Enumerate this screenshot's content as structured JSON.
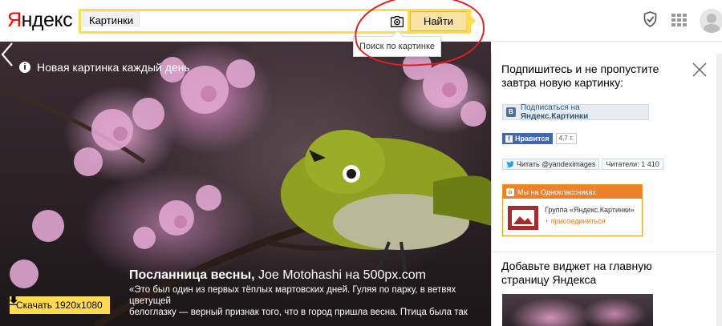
{
  "header": {
    "logo_first": "Я",
    "logo_rest": "ндекс",
    "search_tag": "Картинки",
    "search_value": "",
    "search_button": "Найти",
    "camera_tooltip": "Поиск по картинке",
    "icons": [
      "camera-icon",
      "shield-icon",
      "apps-grid-icon",
      "avatar-icon"
    ]
  },
  "hero": {
    "title": "Новая картинка каждый день",
    "caption_title": "Посланница весны,",
    "caption_author": " Joe Motohashi на 500px.com",
    "caption_text": "«Это был один из первых тёплых мартовских дней. Гуляя по парку, в ветвях цветущей\nбелоглазку — верный признак того, что в город пришла весна. Птица была так увлечен\nмне удалось подойти поближе и сфотографировать её».",
    "download_label": "Скачать 1920x1080"
  },
  "sidebar": {
    "heading": "Подпишитесь и не пропустите завтра новую картинку:",
    "vk": {
      "prefix": "Подписаться на ",
      "name": "Яндекс.Картинки"
    },
    "facebook": {
      "like_label": "Нравится",
      "count": "4,7 т."
    },
    "twitter": {
      "follow_label": "Читать @yandeximages",
      "followers": "Читатели: 1 410"
    },
    "odnoklassniki": {
      "header": "Мы на Одноклассниках",
      "group": "Группа «Яндекс.Картинки»",
      "join": "+ присоединиться"
    },
    "widget_heading": "Добавьте виджет на главную страницу Яндекса"
  },
  "colors": {
    "brand_red": "#ff0000",
    "search_yellow": "#ffdb4d",
    "vk_blue": "#507299",
    "fb_blue": "#4267b2",
    "ok_orange": "#ed812b",
    "annotation_red": "#e02020"
  }
}
